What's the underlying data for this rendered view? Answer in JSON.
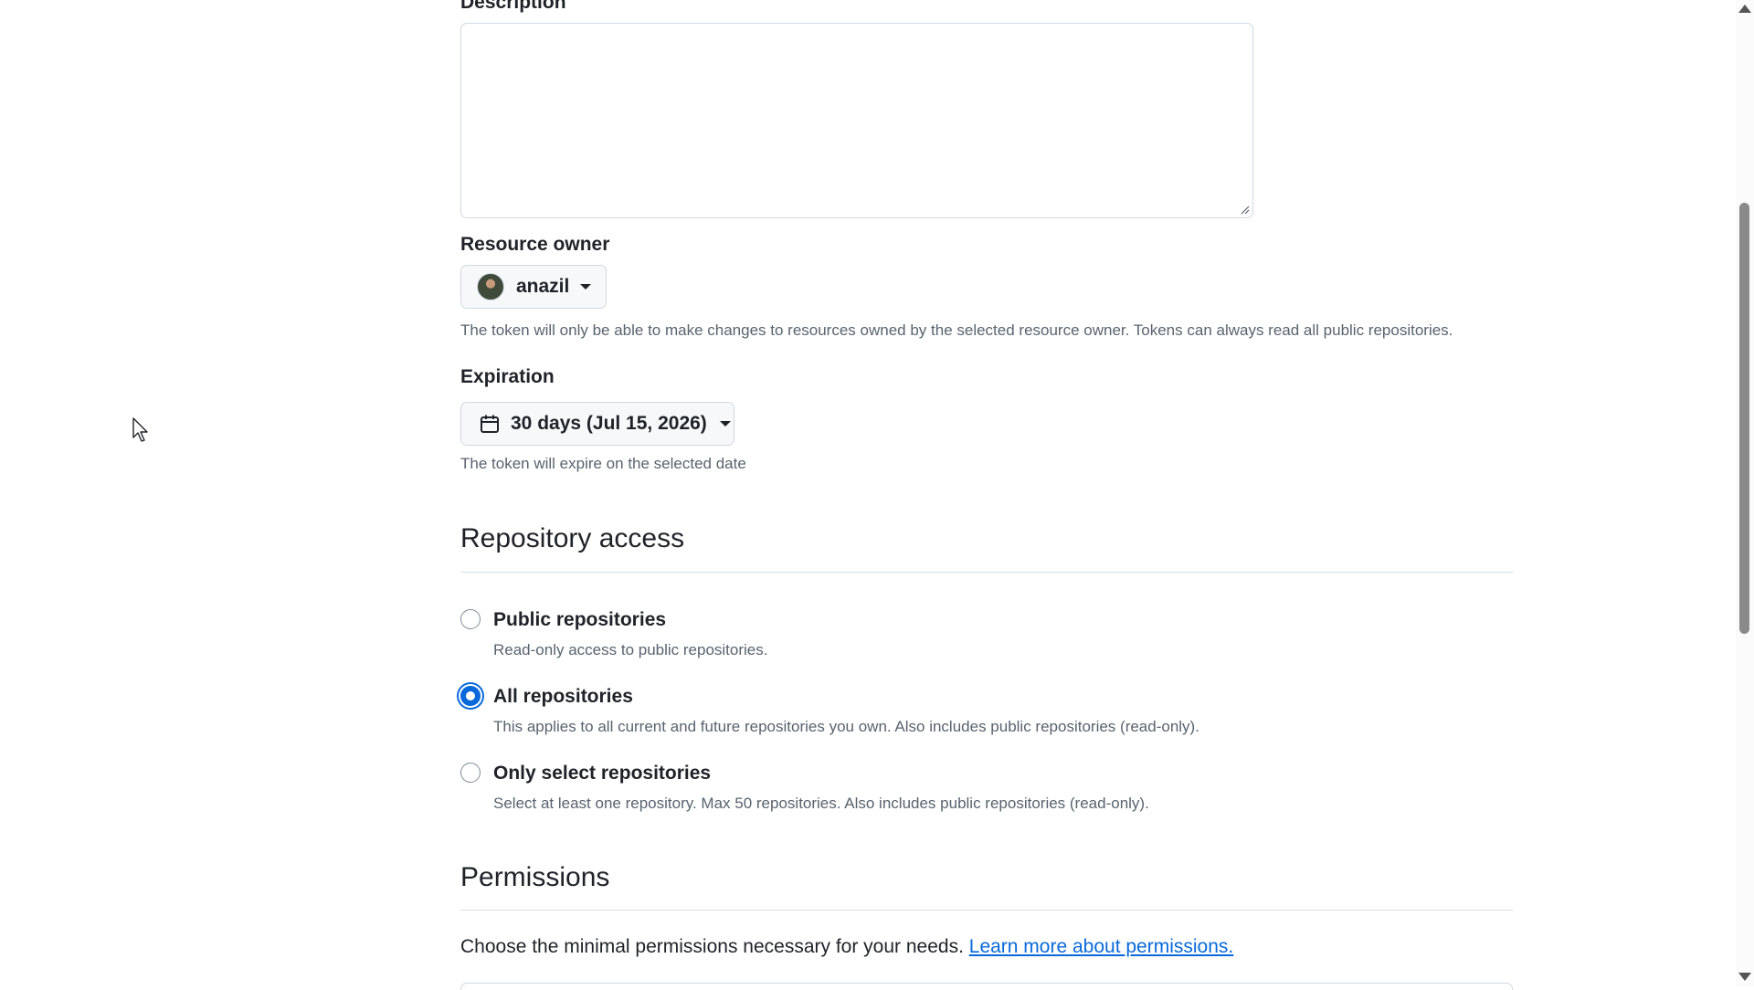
{
  "description": {
    "label": "Description",
    "value": ""
  },
  "resource_owner": {
    "label": "Resource owner",
    "selected": "anazil",
    "note": "The token will only be able to make changes to resources owned by the selected resource owner. Tokens can always read all public repositories."
  },
  "expiration": {
    "label": "Expiration",
    "selected": "30 days (Jul 15, 2026)",
    "note": "The token will expire on the selected date"
  },
  "repository_access": {
    "heading": "Repository access",
    "options": [
      {
        "title": "Public repositories",
        "desc": "Read-only access to public repositories.",
        "checked": false
      },
      {
        "title": "All repositories",
        "desc": "This applies to all current and future repositories you own. Also includes public repositories (read-only).",
        "checked": true
      },
      {
        "title": "Only select repositories",
        "desc": "Select at least one repository. Max 50 repositories. Also includes public repositories (read-only).",
        "checked": false
      }
    ]
  },
  "permissions": {
    "heading": "Permissions",
    "intro": "Choose the minimal permissions necessary for your needs.",
    "link_text": "Learn more about permissions."
  },
  "colors": {
    "accent": "#0969da",
    "text": "#1f2328",
    "muted": "#59636e",
    "border": "#d1d9e0"
  },
  "icons": {
    "calendar": "calendar-icon",
    "caret": "triangle-down-icon",
    "cursor": "mouse-pointer-icon"
  }
}
